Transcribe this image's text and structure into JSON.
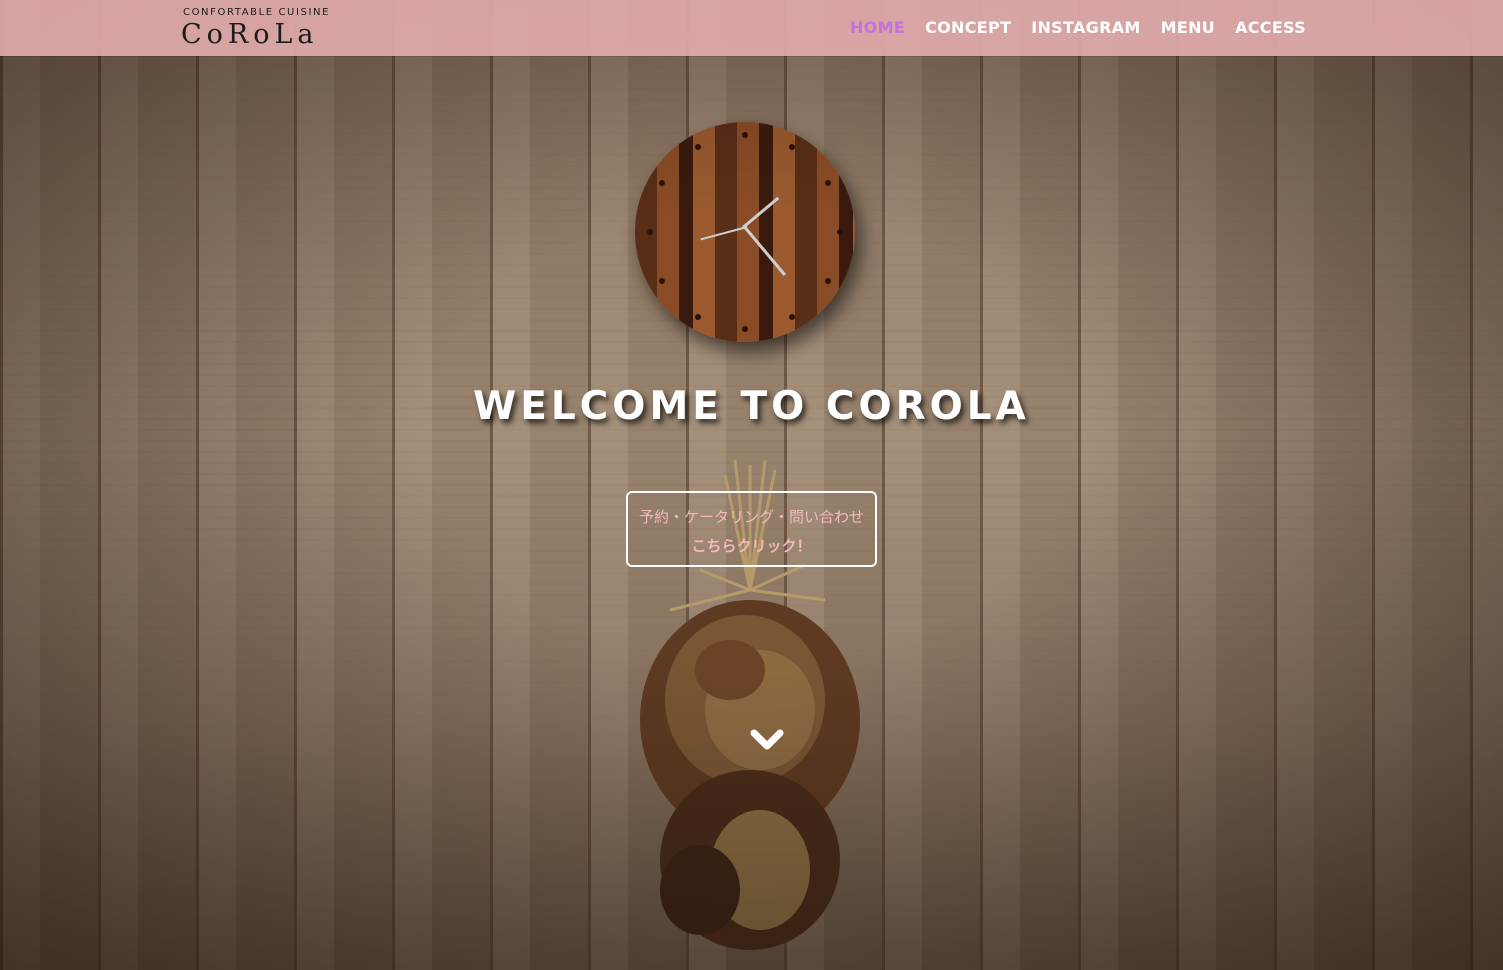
{
  "header": {
    "logo": {
      "tagline": "CONFORTABLE CUISINE",
      "name": "CoRoLa"
    },
    "nav": [
      {
        "label": "HOME",
        "active": true
      },
      {
        "label": "CONCEPT",
        "active": false
      },
      {
        "label": "INSTAGRAM",
        "active": false
      },
      {
        "label": "MENU",
        "active": false
      },
      {
        "label": "ACCESS",
        "active": false
      }
    ]
  },
  "hero": {
    "title": "WELCOME TO COROLA",
    "cta": {
      "line1": "予約・ケータリング・問い合わせ",
      "line2": "こちらクリック！"
    },
    "scroll_icon": "chevron-down-icon"
  },
  "colors": {
    "header_bg": "#dfaaaa",
    "nav_active": "#c56fe1",
    "nav_text": "#ffffff",
    "cta_text": "#f2b9bd",
    "title_text": "#ffffff"
  }
}
